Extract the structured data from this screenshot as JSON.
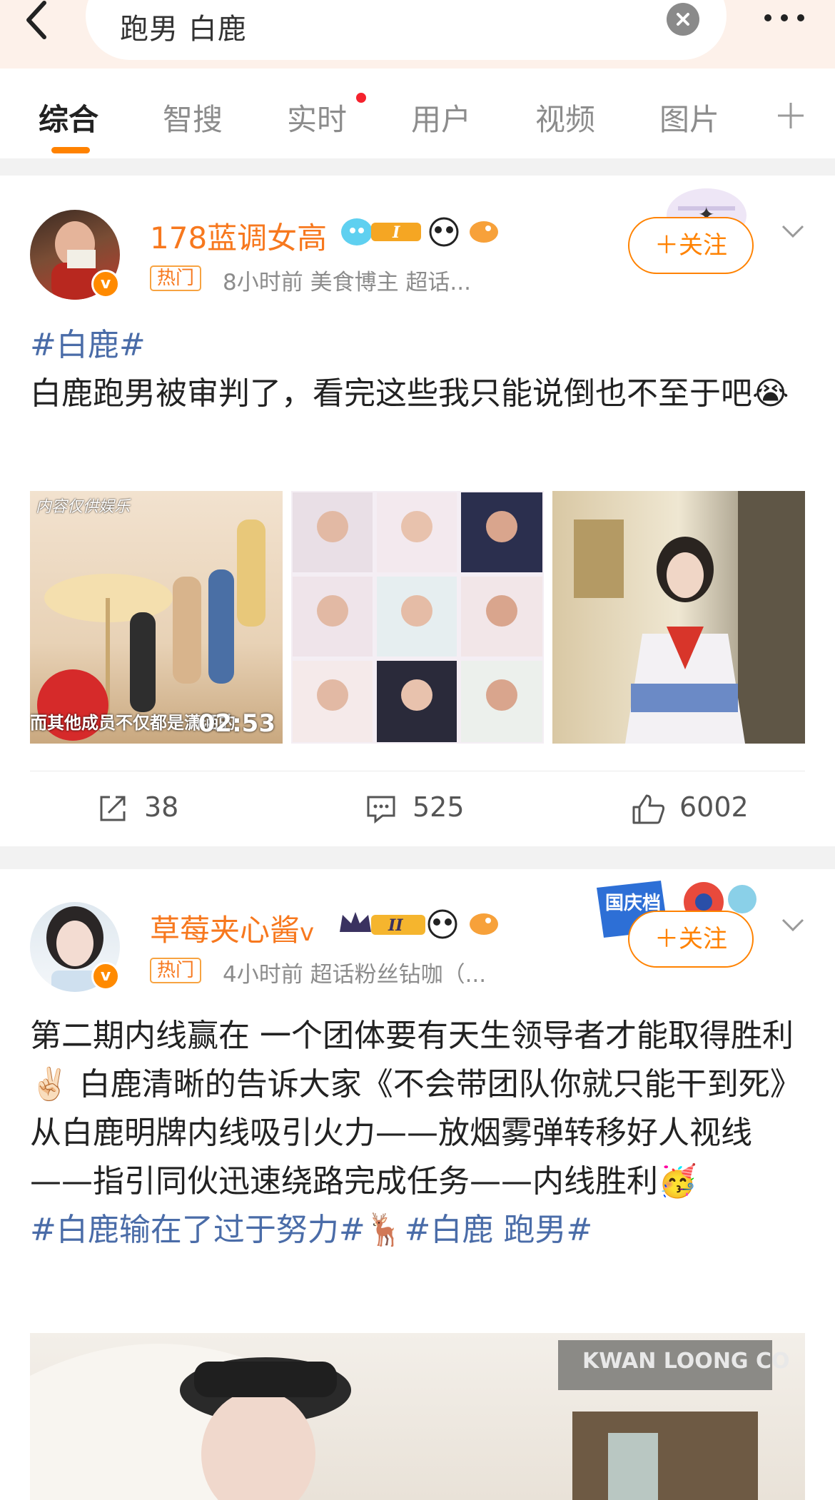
{
  "search": {
    "query": "跑男 白鹿"
  },
  "tabs": [
    "综合",
    "智搜",
    "实时",
    "用户",
    "视频",
    "图片"
  ],
  "posts": [
    {
      "username": "178蓝调女高",
      "hot_tag": "热门",
      "meta": "8小时前  美食博主 超话...",
      "follow_label": "＋关注",
      "topic": "#白鹿#",
      "text": "白鹿跑男被审判了，看完这些我只能说倒也不至于吧😭",
      "image1_caption_top": "内容仅供娱乐",
      "image1_caption_bottom": "而其他成员不仅都是潇洒的",
      "video_duration": "02:53",
      "actions": {
        "repost": "38",
        "comment": "525",
        "like": "6002"
      }
    },
    {
      "username": "草莓夹心酱",
      "vip_mark": "v",
      "hot_tag": "热门",
      "meta": "4小时前  超话粉丝钻咖（...",
      "follow_label": "＋关注",
      "badge_text": "国庆档",
      "text_line1": "第二期内线赢在 一个团体要有天生领导者才能取得胜利✌🏻 白鹿清晰的告诉大家《不会带团队你就只能干到死》",
      "text_line2": "从白鹿明牌内线吸引火力——放烟雾弹转移好人视线——指引同伙迅速绕路完成任务——内线胜利🥳",
      "topic1": "#白鹿输在了过于努力#",
      "emoji_deer": "🦌",
      "topic2": "#白鹿 跑男#",
      "image_sign": "KWAN LOONG CO"
    }
  ]
}
